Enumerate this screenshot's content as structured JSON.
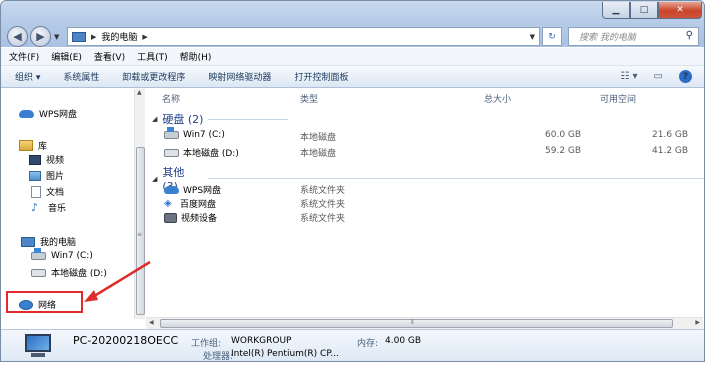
{
  "window": {
    "controls": {
      "min": "▁",
      "max": "□",
      "close": "✕"
    }
  },
  "address": {
    "crumb": "我的电脑",
    "search_placeholder": "搜索 我的电脑"
  },
  "menu": [
    "文件(F)",
    "编辑(E)",
    "查看(V)",
    "工具(T)",
    "帮助(H)"
  ],
  "commands": [
    "组织 ▾",
    "系统属性",
    "卸载或更改程序",
    "映射网络驱动器",
    "打开控制面板"
  ],
  "nav": {
    "items": [
      {
        "label": "WPS网盘",
        "icon": "cloud-icon"
      },
      {
        "label": "库",
        "icon": "library-icon"
      },
      {
        "label": "视频",
        "icon": "video-icon"
      },
      {
        "label": "图片",
        "icon": "picture-icon"
      },
      {
        "label": "文档",
        "icon": "document-icon"
      },
      {
        "label": "音乐",
        "icon": "music-icon"
      },
      {
        "label": "我的电脑",
        "icon": "computer-icon"
      },
      {
        "label": "Win7 (C:)",
        "icon": "drive-c-icon"
      },
      {
        "label": "本地磁盘 (D:)",
        "icon": "drive-d-icon"
      },
      {
        "label": "网络",
        "icon": "network-icon"
      }
    ]
  },
  "columns": {
    "name": "名称",
    "type": "类型",
    "size": "总大小",
    "free": "可用空间"
  },
  "groups": {
    "drives": {
      "title": "硬盘 (2)"
    },
    "other": {
      "title": "其他 (3)"
    }
  },
  "drives": [
    {
      "name": "Win7 (C:)",
      "type": "本地磁盘",
      "size": "60.0 GB",
      "free": "21.6 GB"
    },
    {
      "name": "本地磁盘 (D:)",
      "type": "本地磁盘",
      "size": "59.2 GB",
      "free": "41.2 GB"
    }
  ],
  "others": [
    {
      "name": "WPS网盘",
      "type": "系统文件夹"
    },
    {
      "name": "百度网盘",
      "type": "系统文件夹"
    },
    {
      "name": "视频设备",
      "type": "系统文件夹"
    }
  ],
  "details": {
    "pc_name": "PC-20200218OECC",
    "workgroup_label": "工作组:",
    "workgroup": "WORKGROUP",
    "memory_label": "内存:",
    "memory": "4.00 GB",
    "cpu_label": "处理器:",
    "cpu": "Intel(R) Pentium(R) CP..."
  },
  "colors": {
    "highlight": "#e02b2b",
    "group_title": "#1e3f8a",
    "accent": "#2d6cc0"
  }
}
